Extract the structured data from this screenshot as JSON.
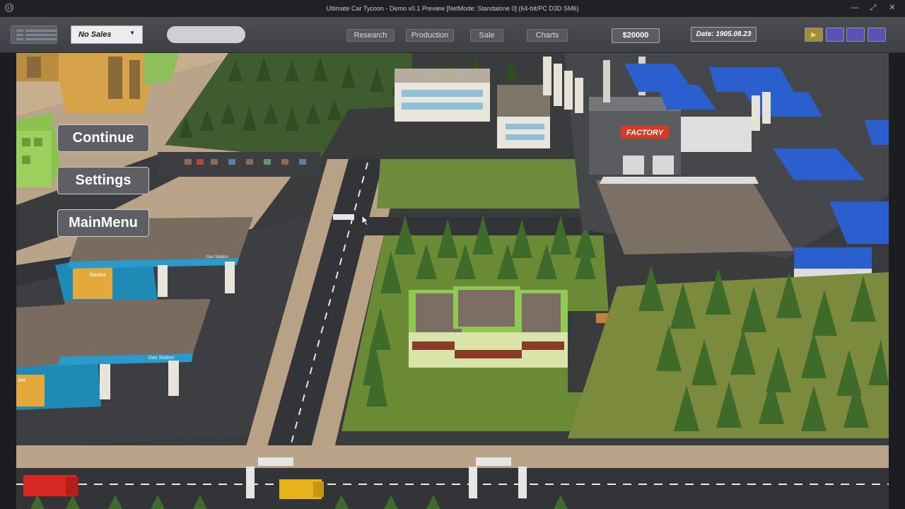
{
  "window": {
    "title": "Ultimate Car Tycoon - Demo v0.1 Preview [NetMode: Standalone 0]  (64-bit/PC D3D SM6)",
    "minimize_glyph": "—",
    "restore_glyph": "⤢",
    "close_glyph": "✕"
  },
  "toolbar": {
    "sales_select_value": "No Sales",
    "sales_select_chevron": "▼",
    "research_label": "Research",
    "production_label": "Production",
    "sale_label": "Sale",
    "charts_label": "Charts",
    "money": "$20000",
    "date": "Date: 1905.08.23",
    "play_glyph": "▶",
    "speed_colors": [
      "#a28b3a",
      "#5a52b4",
      "#5a52b4",
      "#5a52b4"
    ]
  },
  "pause_menu": {
    "continue_label": "Continue",
    "settings_label": "Settings",
    "main_menu_label": "MainMenu"
  },
  "scene_signs": {
    "factory": "FACTORY",
    "gas_station_1": "Gas Station",
    "gas_station_2": "Gas Station",
    "market_1": "Market",
    "market_2": "ket"
  }
}
